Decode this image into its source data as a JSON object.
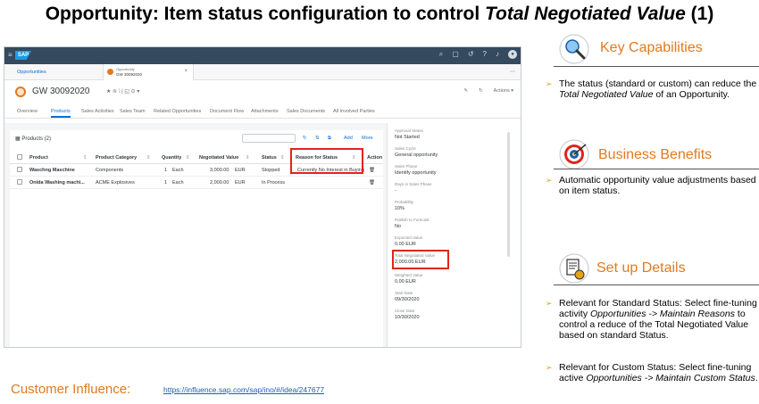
{
  "slide": {
    "title_prefix": "Opportunity: Item status configuration to control ",
    "title_italic": "Total Negotiated Value",
    "title_suffix": " (1)"
  },
  "shell": {
    "logo": "SAP",
    "icons": [
      "search-icon",
      "chat-icon",
      "history-icon",
      "help-icon",
      "bell-icon",
      "user-avatar"
    ]
  },
  "tabs": {
    "opportunities": "Opportunities",
    "doc_type": "Opportunity",
    "doc_id": "GW 30092020",
    "close": "×",
    "more": "⋯"
  },
  "object": {
    "title": "GW 30092020",
    "actions_label": "Actions ▾",
    "subtabs": [
      "Overview",
      "Products",
      "Sales Activities",
      "Sales Team",
      "Related Opportunities",
      "Document Flow",
      "Attachments",
      "Sales Documents",
      "All Involved Parties"
    ],
    "active_subtab": "Products"
  },
  "products": {
    "title": "Products (2)",
    "tools": [
      "Add",
      "More"
    ],
    "columns": [
      "Product",
      "Product Category",
      "Quantity",
      "Negotiated Value",
      "Status",
      "Reason for Status",
      "Action"
    ],
    "rows": [
      {
        "product": "Waschng Maschine",
        "category": "Components",
        "qty": "1",
        "unit": "Each",
        "value": "3,000.00",
        "currency": "EUR",
        "status": "Stopped",
        "reason": "Currently No Interest in Buying"
      },
      {
        "product": "Onida Washing machi...",
        "category": "ACME Explosives",
        "qty": "1",
        "unit": "Each",
        "value": "2,000.00",
        "currency": "EUR",
        "status": "In Process",
        "reason": ""
      }
    ]
  },
  "side_panel": {
    "fields": [
      {
        "label": "Approval Status",
        "value": "Not Started"
      },
      {
        "label": "Sales Cycle",
        "value": "General opportunity"
      },
      {
        "label": "Sales Phase",
        "value": "Identify opportunity"
      },
      {
        "label": "Days in Sales Phase",
        "value": "-"
      },
      {
        "label": "Probability",
        "value": "10%"
      },
      {
        "label": "Publish to Forecast",
        "value": "No"
      },
      {
        "label": "Expected Value",
        "value": "0.00  EUR"
      },
      {
        "label": "Total Negotiated Value",
        "value": "2,000.00  EUR"
      },
      {
        "label": "Weighted Value",
        "value": "0.00  EUR"
      },
      {
        "label": "Start Date",
        "value": "09/30/2020"
      },
      {
        "label": "Close Date",
        "value": "10/30/2020"
      }
    ]
  },
  "key_capabilities": {
    "heading": "Key Capabilities",
    "text_before": "The status (standard or custom) can reduce the ",
    "text_italic": "Total Negotiated Value",
    "text_after": " of an Opportunity."
  },
  "business_benefits": {
    "heading": "Business Benefits",
    "text": "Automatic opportunity value adjustments based on item status."
  },
  "setup": {
    "heading": "Set up Details",
    "b1_before": "Relevant for Standard Status: Select fine-tuning activity ",
    "b1_italic": "Opportunities -> Maintain Reasons",
    "b1_after": " to control a reduce of the Total Negotiated Value based on standard Status.",
    "b2_before": "Relevant for Custom Status: Select fine-tuning active ",
    "b2_italic": "Opportunities ->  Maintain Custom Status",
    "b2_after": "."
  },
  "footer": {
    "label": "Customer Influence:",
    "link": "https://influence.sap.com/sap/ino/#/idea/247677"
  },
  "colors": {
    "accent": "#e07a1f",
    "highlight": "#e0241c",
    "shell": "#354a5f",
    "link": "#0a6ed1"
  }
}
